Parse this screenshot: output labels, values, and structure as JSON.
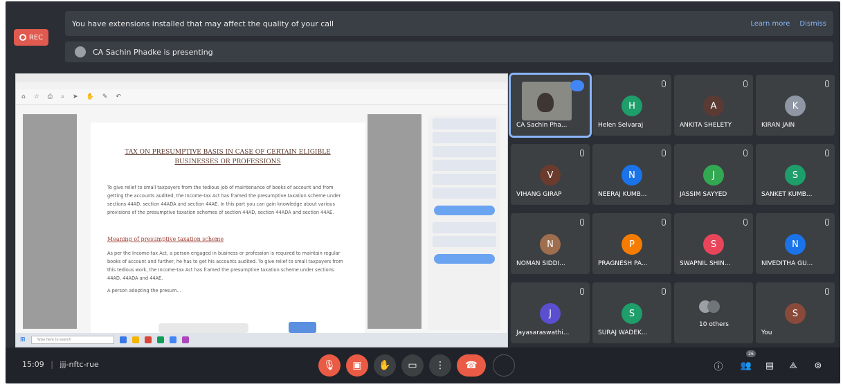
{
  "recording": {
    "label": "REC"
  },
  "extension_banner": {
    "text": "You have extensions installed that may affect the quality of your call",
    "learn_more": "Learn more",
    "dismiss": "Dismiss"
  },
  "presenting_banner": {
    "text": "CA Sachin Phadke is presenting"
  },
  "document": {
    "heading": "TAX ON PRESUMPTIVE BASIS IN CASE OF CERTAIN ELIGIBLE BUSINESSES OR PROFESSIONS",
    "intro": "To give relief to small taxpayers from the tedious job of maintenance of books of account and from getting the accounts audited, the Income-tax Act has framed the presumptive taxation scheme under sections 44AD, section 44ADA and section 44AE. In this part you can gain knowledge about various provisions of the presumptive taxation schemes of section 44AD, section 44ADA and section 44AE.",
    "subheading": "Meaning of presumptive taxation scheme",
    "body": "As per the Income-tax Act, a person engaged in business or profession is required to maintain regular books of account and further, he has to get his accounts audited. To give relief to small taxpayers from this tedious work, the Income-tax Act has framed the presumptive taxation scheme under sections 44AD, 44ADA and 44AE.",
    "body_tail": "A person adopting the presum...",
    "taskbar_search": "Type here to search"
  },
  "participants": [
    {
      "name": "CA Sachin Pha...",
      "initial": "",
      "color": "",
      "camera": true
    },
    {
      "name": "Helen Selvaraj",
      "initial": "H",
      "color": "#1e9e6a"
    },
    {
      "name": "ANKITA SHELETY",
      "initial": "A",
      "color": "#5b3a34"
    },
    {
      "name": "KIRAN JAIN",
      "initial": "K",
      "color": "#8e97a3"
    },
    {
      "name": "VIHANG GIRAP",
      "initial": "V",
      "color": "#6b3b2e"
    },
    {
      "name": "NEERAJ KUMB...",
      "initial": "N",
      "color": "#1a73e8"
    },
    {
      "name": "JASSIM SAYYED",
      "initial": "J",
      "color": "#33a852"
    },
    {
      "name": "SANKET KUMB...",
      "initial": "S",
      "color": "#1e9e6a"
    },
    {
      "name": "NOMAN SIDDI...",
      "initial": "N",
      "color": "#9e6e4f"
    },
    {
      "name": "PRAGNESH PA...",
      "initial": "P",
      "color": "#f57c00"
    },
    {
      "name": "SWAPNIL SHIN...",
      "initial": "S",
      "color": "#e8455b"
    },
    {
      "name": "NIVEDITHA GU...",
      "initial": "N",
      "color": "#1a73e8"
    },
    {
      "name": "Jayasaraswathi...",
      "initial": "J",
      "color": "#5a4fcf"
    },
    {
      "name": "SURAJ WADEK...",
      "initial": "S",
      "color": "#1e9e6a"
    },
    {
      "name": "10 others",
      "initial": "",
      "color": "",
      "others": true
    },
    {
      "name": "You",
      "initial": "S",
      "color": "#8a4a3a"
    }
  ],
  "meeting": {
    "time": "15:09",
    "code": "jjj-nftc-rue"
  },
  "controls": {
    "mic_icon": "microphone-off-icon",
    "cam_icon": "camera-off-icon",
    "hand_icon": "raise-hand-icon",
    "present_icon": "present-screen-icon",
    "more_icon": "more-options-icon",
    "hangup_icon": "hang-up-icon",
    "people_count": "26"
  }
}
